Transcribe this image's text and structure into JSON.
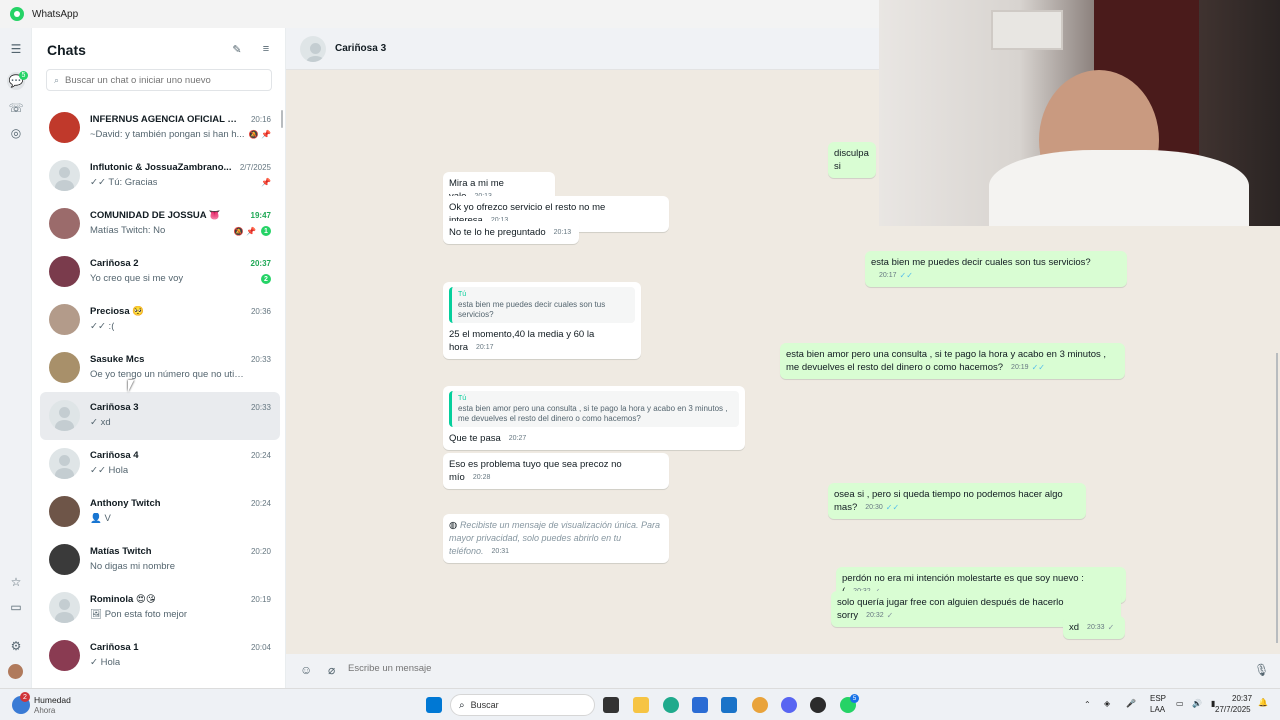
{
  "app": {
    "title": "WhatsApp"
  },
  "rail": {
    "chats_badge": "5"
  },
  "sidebar": {
    "title": "Chats",
    "search_placeholder": "Buscar un chat o iniciar uno nuevo",
    "chats": [
      {
        "name": "INFERNUS AGENCIA OFICIAL DE...",
        "time": "20:16",
        "preview": "~David: y también pongan si han h...",
        "unread": "",
        "icons": "🔕 📌"
      },
      {
        "name": "Influtonic & JossuaZambrano...",
        "time": "2/7/2025",
        "preview": "✓✓ Tú: Gracias",
        "unread": "",
        "icons": "📌"
      },
      {
        "name": "COMUNIDAD DE JOSSUA 👅",
        "time": "19:47",
        "preview": "Matías Twitch: No",
        "unread": "1",
        "icons": "🔕 📌"
      },
      {
        "name": "Cariñosa 2",
        "time": "20:37",
        "preview": "Yo creo que si me voy",
        "unread": "2",
        "icons": ""
      },
      {
        "name": "Preciosa 🥺",
        "time": "20:36",
        "preview": "✓✓ :(",
        "unread": "",
        "icons": ""
      },
      {
        "name": "Sasuke Mcs",
        "time": "20:33",
        "preview": "Oe yo tengo un número que no utilizo...",
        "unread": "",
        "icons": ""
      },
      {
        "name": "Cariñosa 3",
        "time": "20:33",
        "preview": "✓ xd",
        "unread": "",
        "icons": ""
      },
      {
        "name": "Cariñosa 4",
        "time": "20:24",
        "preview": "✓✓ Hola",
        "unread": "",
        "icons": ""
      },
      {
        "name": "Anthony Twitch",
        "time": "20:24",
        "preview": "👤 V",
        "unread": "",
        "icons": ""
      },
      {
        "name": "Matías Twitch",
        "time": "20:20",
        "preview": "No digas mi nombre",
        "unread": "",
        "icons": ""
      },
      {
        "name": "Rominola 😍😘",
        "time": "20:19",
        "preview": "🖼 Pon esta foto mejor",
        "unread": "",
        "icons": ""
      },
      {
        "name": "Cariñosa 1",
        "time": "20:04",
        "preview": "✓ Hola",
        "unread": "",
        "icons": ""
      }
    ]
  },
  "conversation": {
    "contact": "Cariñosa 3",
    "messages": [
      {
        "dir": "out",
        "text": "disculpa si",
        "time": ""
      },
      {
        "dir": "in",
        "text": "Mira a mi me vale",
        "time": "20:13"
      },
      {
        "dir": "in",
        "text": "Ok yo ofrezco servicio el resto no me interesa",
        "time": "20:13"
      },
      {
        "dir": "in",
        "text": "No te lo he preguntado",
        "time": "20:13"
      },
      {
        "dir": "out",
        "text": "esta bien me puedes decir cuales son tus servicios?",
        "time": "20:17"
      },
      {
        "dir": "in",
        "quote_name": "Tú",
        "quote": "esta bien me puedes decir cuales son tus servicios?",
        "text": "25 el momento,40 la media y 60 la hora",
        "time": "20:17"
      },
      {
        "dir": "out",
        "text": "esta bien amor pero una consulta , si te pago la hora y acabo en 3 minutos , me devuelves el resto del dinero o como hacemos?",
        "time": "20:19"
      },
      {
        "dir": "in",
        "quote_name": "Tú",
        "quote": "esta bien amor pero una consulta , si te pago la hora y acabo en 3 minutos , me devuelves el resto del dinero o como hacemos?",
        "text": "Que te pasa",
        "time": "20:27"
      },
      {
        "dir": "in",
        "text": "Eso es problema tuyo que sea precoz no mío",
        "time": "20:28"
      },
      {
        "dir": "out",
        "text": "osea si , pero si queda tiempo no podemos hacer algo mas?",
        "time": "20:30"
      },
      {
        "dir": "in",
        "text": "Recibiste un mensaje de visualización única. Para mayor privacidad, solo puedes abrirlo en tu teléfono.",
        "time": "20:31"
      },
      {
        "dir": "out",
        "text": "perdón no era mi intención molestarte es que soy nuevo :(",
        "time": "20:32"
      },
      {
        "dir": "out",
        "text": "solo quería jugar free con alguien después de hacerlo sorry",
        "time": "20:32"
      },
      {
        "dir": "out",
        "text": "xd",
        "time": "20:33"
      }
    ],
    "composer_placeholder": "Escribe un mensaje"
  },
  "taskbar": {
    "weather_label": "Humedad",
    "weather_sub": "Ahora",
    "weather_badge": "2",
    "search_label": "Buscar",
    "lang": "ESP",
    "lang_sub": "LAA",
    "clock_time": "20:37",
    "clock_date": "27/7/2025",
    "whatsapp_badge": "5"
  }
}
